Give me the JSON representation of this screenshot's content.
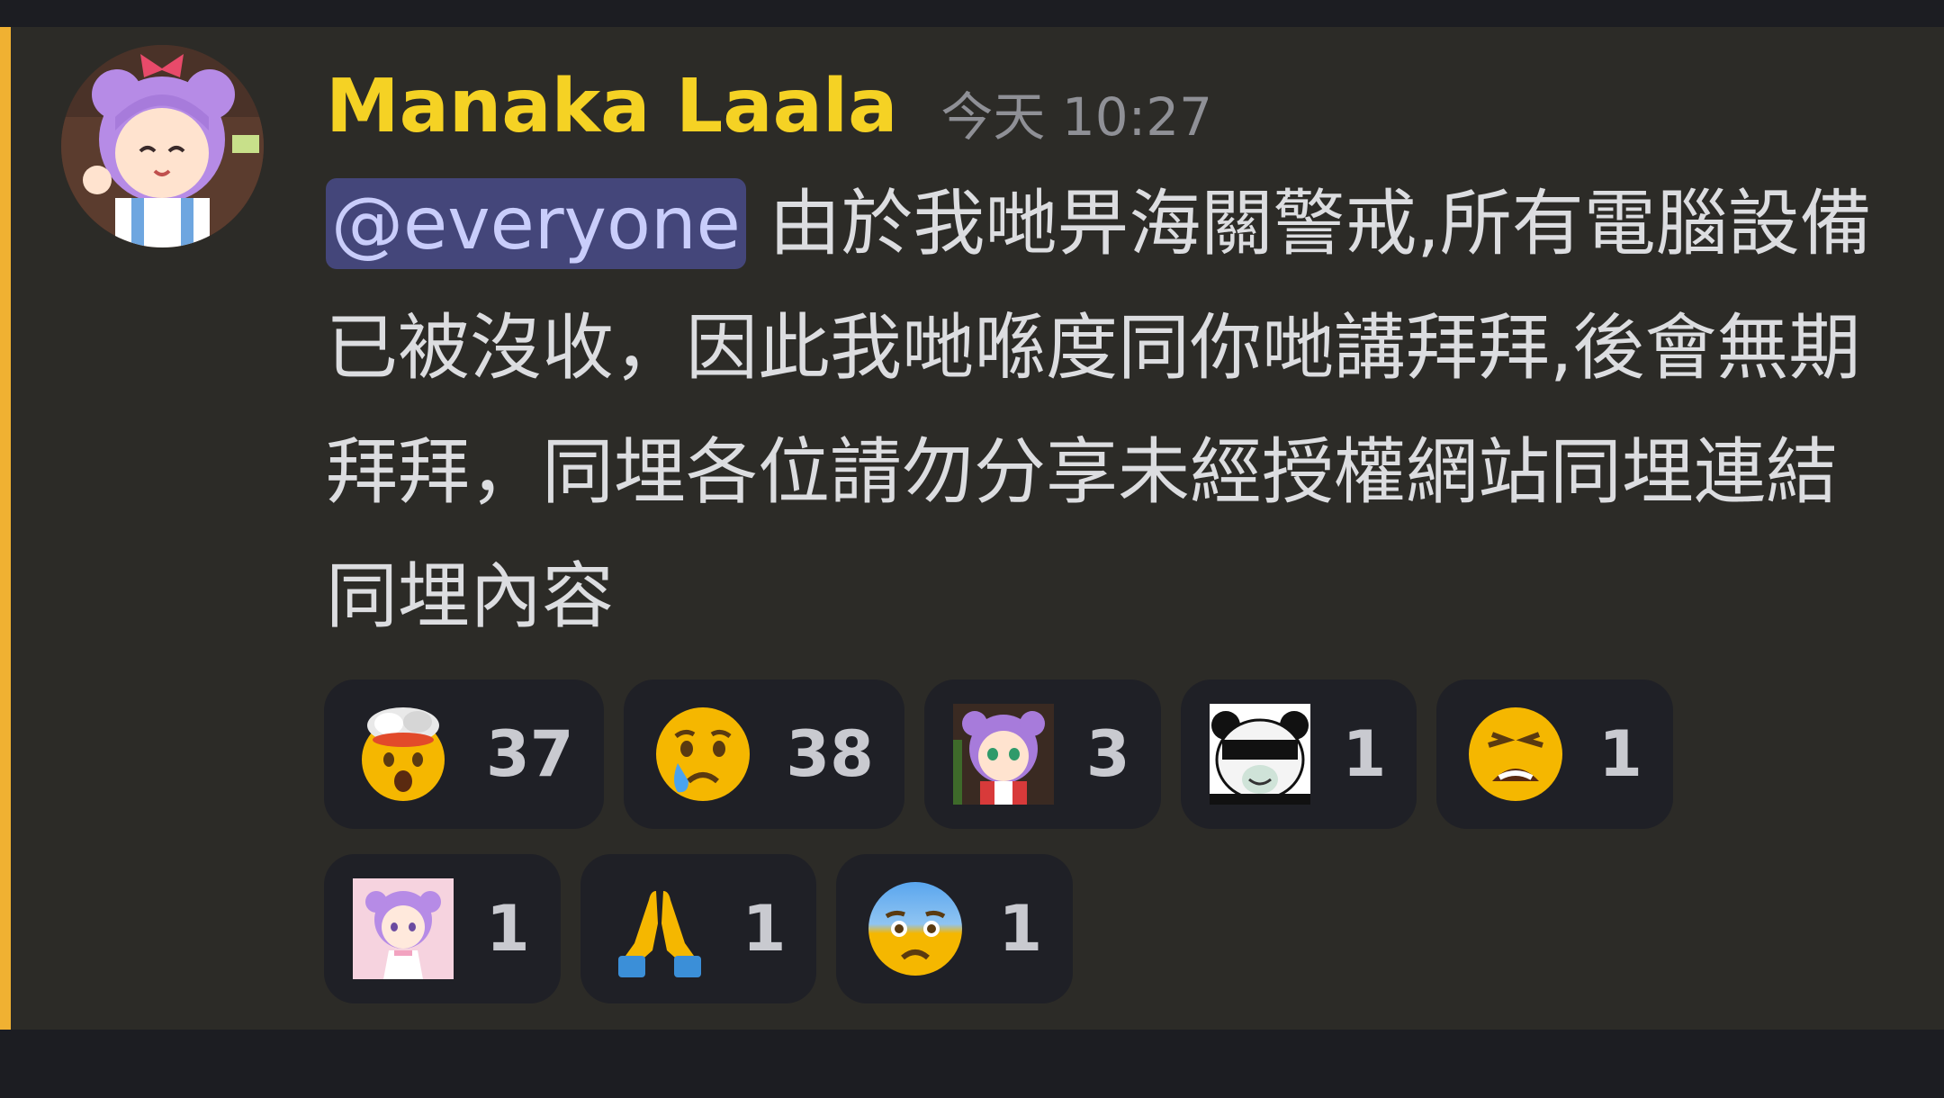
{
  "message": {
    "author": "Manaka Laala",
    "timestamp": "今天 10:27",
    "mention": "@everyone",
    "text": "由於我哋畀海關警戒,所有電腦設備已被沒收，因此我哋喺度同你哋講拜拜,後會無期拜拜，同埋各位請勿分享未經授權網站同埋連結同埋內容",
    "accent_color": "#f0b132",
    "author_color": "#f5d224"
  },
  "reactions": [
    {
      "emoji": "exploding-head-icon",
      "count": "37"
    },
    {
      "emoji": "crying-face-icon",
      "count": "38"
    },
    {
      "emoji": "anime-girl-sticker-icon",
      "count": "3"
    },
    {
      "emoji": "panda-meme-sticker-icon",
      "count": "1"
    },
    {
      "emoji": "weary-face-icon",
      "count": "1"
    },
    {
      "emoji": "anime-girl-pink-sticker-icon",
      "count": "1"
    },
    {
      "emoji": "folded-hands-icon",
      "count": "1"
    },
    {
      "emoji": "anxious-sweat-face-icon",
      "count": "1"
    }
  ]
}
